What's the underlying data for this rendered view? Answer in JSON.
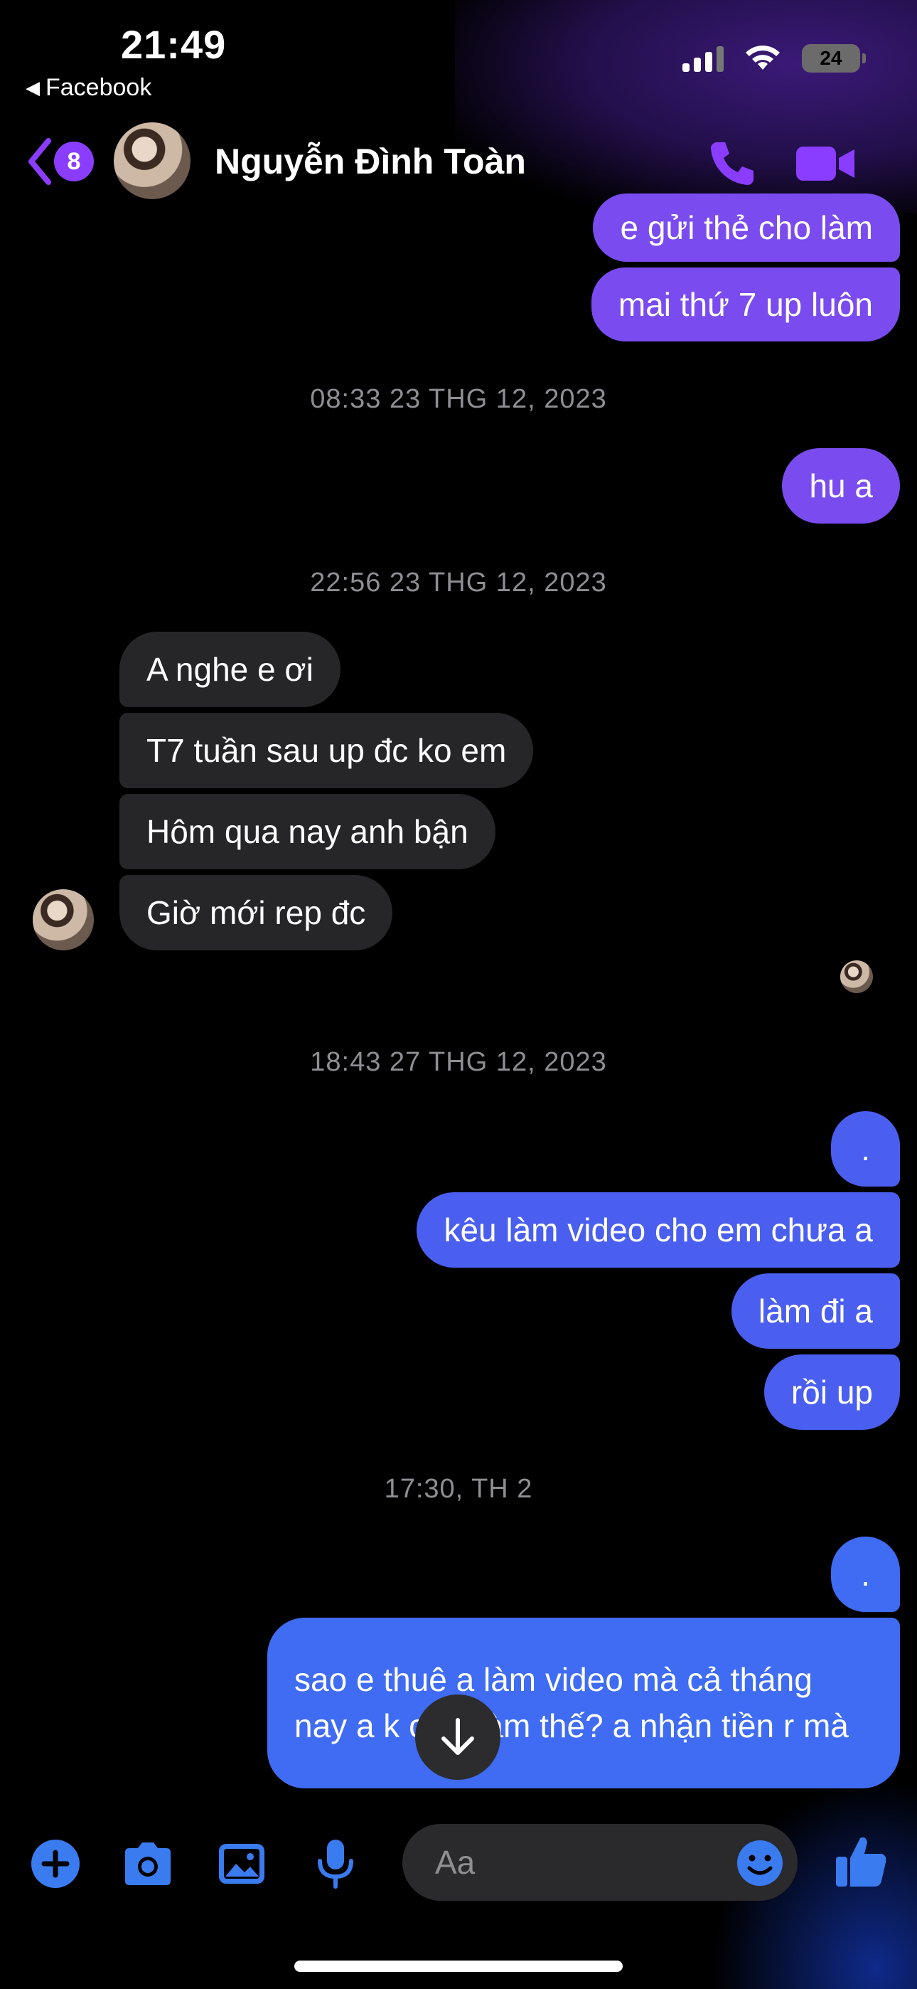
{
  "status_bar": {
    "time": "21:49",
    "back_app": "Facebook",
    "battery": "24"
  },
  "header": {
    "unread_count": "8",
    "contact_name": "Nguyễn Đình Toàn",
    "accent_color": "#8b3dff"
  },
  "messages": [
    {
      "from": "me",
      "text": "e gửi thẻ cho làm"
    },
    {
      "from": "me",
      "text": "mai thứ 7 up luôn"
    },
    {
      "type": "timestamp",
      "text": "08:33 23 THG 12, 2023"
    },
    {
      "from": "me",
      "text": "hu a"
    },
    {
      "type": "timestamp",
      "text": "22:56 23 THG 12, 2023"
    },
    {
      "from": "them",
      "text": "A nghe e ơi"
    },
    {
      "from": "them",
      "text": "T7 tuần sau up đc ko em"
    },
    {
      "from": "them",
      "text": "Hôm qua nay anh bận"
    },
    {
      "from": "them",
      "text": "Giờ mới rep đc"
    },
    {
      "type": "timestamp",
      "text": "18:43 27 THG 12, 2023"
    },
    {
      "from": "me",
      "text": "."
    },
    {
      "from": "me",
      "text": "kêu làm video cho em chưa a"
    },
    {
      "from": "me",
      "text": "làm đi a"
    },
    {
      "from": "me",
      "text": "rồi up"
    },
    {
      "type": "timestamp",
      "text": "17:30, TH 2"
    },
    {
      "from": "me",
      "text": "."
    },
    {
      "from": "me",
      "text": "sao e thuê a làm video mà cả tháng nay a k chịu làm thế? a nhận tiền r mà"
    }
  ],
  "composer": {
    "placeholder": "Aa",
    "icons": [
      "plus-icon",
      "camera-icon",
      "image-icon",
      "microphone-icon",
      "emoji-icon",
      "thumbs-up-icon"
    ]
  },
  "colors": {
    "bubble_purple": "#7a4cf0",
    "bubble_blue": "#4a5ff0",
    "bubble_them": "#262628",
    "composer_blue": "#3a7bf0"
  }
}
